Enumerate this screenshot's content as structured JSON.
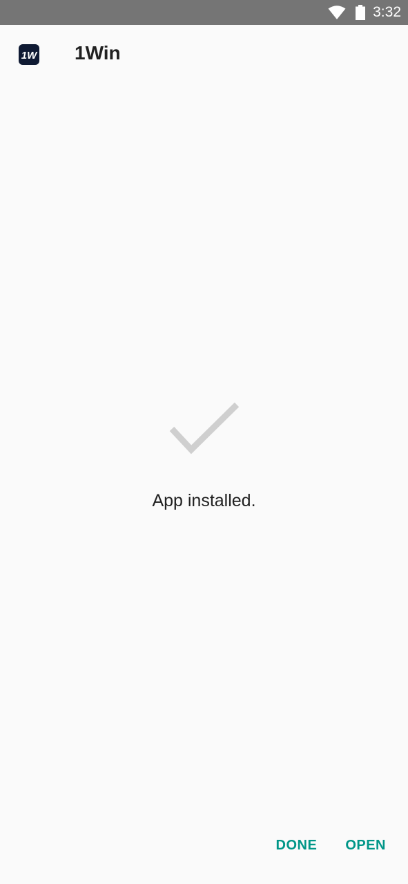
{
  "status_bar": {
    "time": "3:32",
    "icons": [
      "wifi-icon",
      "battery-icon"
    ],
    "background": "#757575"
  },
  "app": {
    "name": "1Win",
    "icon_label": "1W",
    "icon_background": "#0f1a33"
  },
  "content": {
    "status_icon": "checkmark-icon",
    "message": "App installed."
  },
  "actions": {
    "done_label": "DONE",
    "open_label": "OPEN",
    "accent_color": "#009688"
  }
}
